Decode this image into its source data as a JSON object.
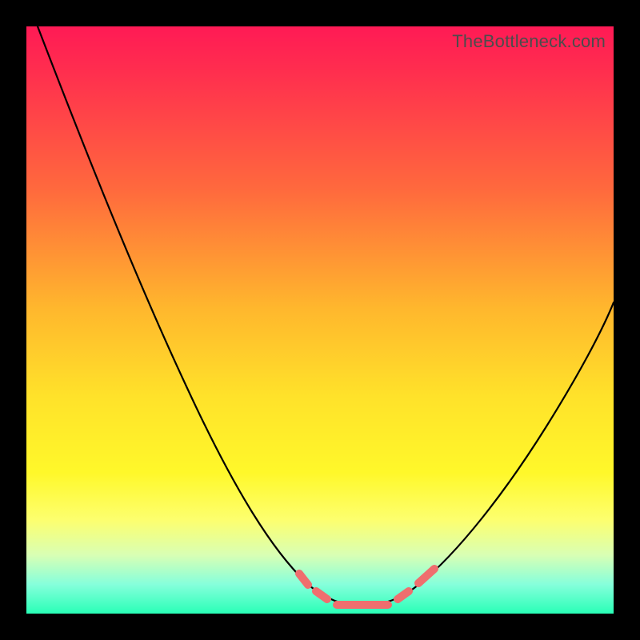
{
  "watermark": "TheBottleneck.com",
  "colors": {
    "frame": "#000000",
    "gradient_top": "#ff1a55",
    "gradient_mid": "#ffe22a",
    "gradient_bottom": "#29ffb7",
    "curve": "#000000",
    "dash": "#ef6e6e"
  },
  "chart_data": {
    "type": "line",
    "title": "",
    "xlabel": "",
    "ylabel": "",
    "xlim": [
      0,
      100
    ],
    "ylim": [
      0,
      100
    ],
    "grid": false,
    "legend": false,
    "series": [
      {
        "name": "bottleneck-curve",
        "x": [
          2,
          6,
          10,
          14,
          18,
          22,
          26,
          30,
          34,
          38,
          42,
          46,
          50,
          52,
          54,
          56,
          58,
          60,
          64,
          68,
          72,
          76,
          80,
          84,
          88,
          92,
          96,
          100
        ],
        "y": [
          100,
          92,
          84,
          76,
          68,
          60,
          52,
          44,
          37,
          30,
          24,
          18,
          12,
          9,
          6,
          4,
          3,
          3,
          4,
          7,
          12,
          18,
          25,
          32,
          40,
          48,
          56,
          62
        ]
      }
    ],
    "highlight_dashes": {
      "description": "salmon dash segments near curve bottom indicating optimal range",
      "segments_x_ranges": [
        [
          49,
          51
        ],
        [
          52,
          54
        ],
        [
          55,
          64
        ],
        [
          65,
          67
        ],
        [
          68,
          71
        ]
      ]
    }
  }
}
